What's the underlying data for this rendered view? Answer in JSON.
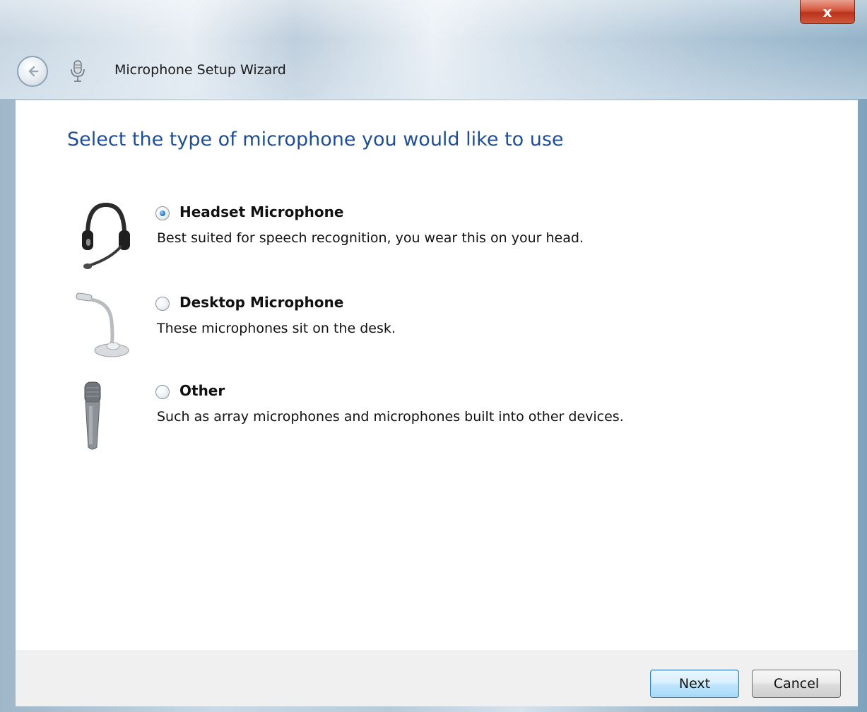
{
  "window": {
    "title": "Microphone Setup Wizard",
    "close_label": "x"
  },
  "main": {
    "heading": "Select the type of microphone you would like to use",
    "options": [
      {
        "label": "Headset Microphone",
        "description": "Best suited for speech recognition, you wear this on your head.",
        "selected": true,
        "icon": "headset-microphone-icon"
      },
      {
        "label": "Desktop Microphone",
        "description": "These microphones sit on the desk.",
        "selected": false,
        "icon": "desktop-microphone-icon"
      },
      {
        "label": "Other",
        "description": "Such as array microphones and microphones built into other devices.",
        "selected": false,
        "icon": "handheld-microphone-icon"
      }
    ]
  },
  "footer": {
    "next_label": "Next",
    "cancel_label": "Cancel"
  },
  "colors": {
    "heading": "#1f4e94",
    "close_button": "#c8442a",
    "selected_radio": "#2b7ad1"
  }
}
